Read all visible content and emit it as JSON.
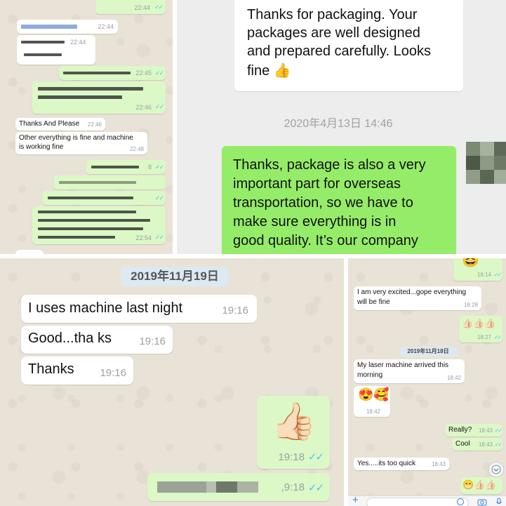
{
  "panel_top_left": {
    "messages": [
      {
        "time": "22:44"
      },
      {
        "time": "22:44"
      },
      {
        "time": "22:44"
      },
      {
        "time": "22:45"
      },
      {
        "time": "22:46"
      },
      {
        "text": "Thanks And Please",
        "time": "22:46"
      },
      {
        "text_line1": "Other everything is fine and machine",
        "text_line2": "is working fine",
        "time": "22:48"
      },
      {
        "time": "8"
      },
      {
        "time": "22:54"
      }
    ],
    "ticks": "✓✓"
  },
  "panel_top_right": {
    "incoming": {
      "lines": [
        "Thanks for packaging. Your",
        "packages are well designed",
        "and prepared carefully. Looks",
        "fine 👍"
      ]
    },
    "date_label": "2020年4月13日 14:46",
    "outgoing": {
      "lines": [
        "Thanks, package is also a very",
        "important part for overseas",
        "transportation, so we have to",
        "make sure everything is in",
        "good quality. It’s our company"
      ]
    }
  },
  "panel_bottom_left": {
    "date_label": "2019年11月19日",
    "messages": [
      {
        "text": "I uses machine last night",
        "time": "19:16"
      },
      {
        "text": "Good...tha ks",
        "time": "19:16"
      },
      {
        "text": "Thanks",
        "time": "19:16"
      }
    ],
    "sticker": {
      "emoji": "👍🏻",
      "time": "19:18"
    },
    "blurred_time": ",9:18",
    "ticks": "✓✓"
  },
  "panel_bottom_right": {
    "top_emoji_time": "18:14",
    "excited": {
      "line1": "I am very excited...gope everything",
      "line2": "will be fine",
      "time": "18:28"
    },
    "thumbs": {
      "emoji": "👍🏻👍🏻👍🏻",
      "time": "18:27"
    },
    "date_label": "2019年11月18日",
    "arrived": {
      "line1": "My laser machine arrived this",
      "line2": "morning",
      "time": "18:42"
    },
    "hearts": {
      "emoji": "😍🥰",
      "time": "18:42"
    },
    "really": {
      "text": "Really?",
      "time": "18:43"
    },
    "cool": {
      "text": "Cool",
      "time": "18:43"
    },
    "quick": {
      "text": "Yes.....its too quick",
      "time": "18:43"
    },
    "last_emoji": "😁👍🏻👍🏻",
    "ticks": "✓✓",
    "plus_icon": "plus-icon",
    "scroll_down_icon": "chevron-down-icon",
    "camera_icon": "camera-icon",
    "mic_icon": "microphone-icon"
  },
  "colors": {
    "wa_background": "#e9e2d6",
    "incoming_bubble": "#ffffff",
    "outgoing_bubble": "#dcf8c6",
    "wechat_green": "#95ec69",
    "read_ticks": "#4fc3f7",
    "timestamp": "#9aa1a6"
  }
}
